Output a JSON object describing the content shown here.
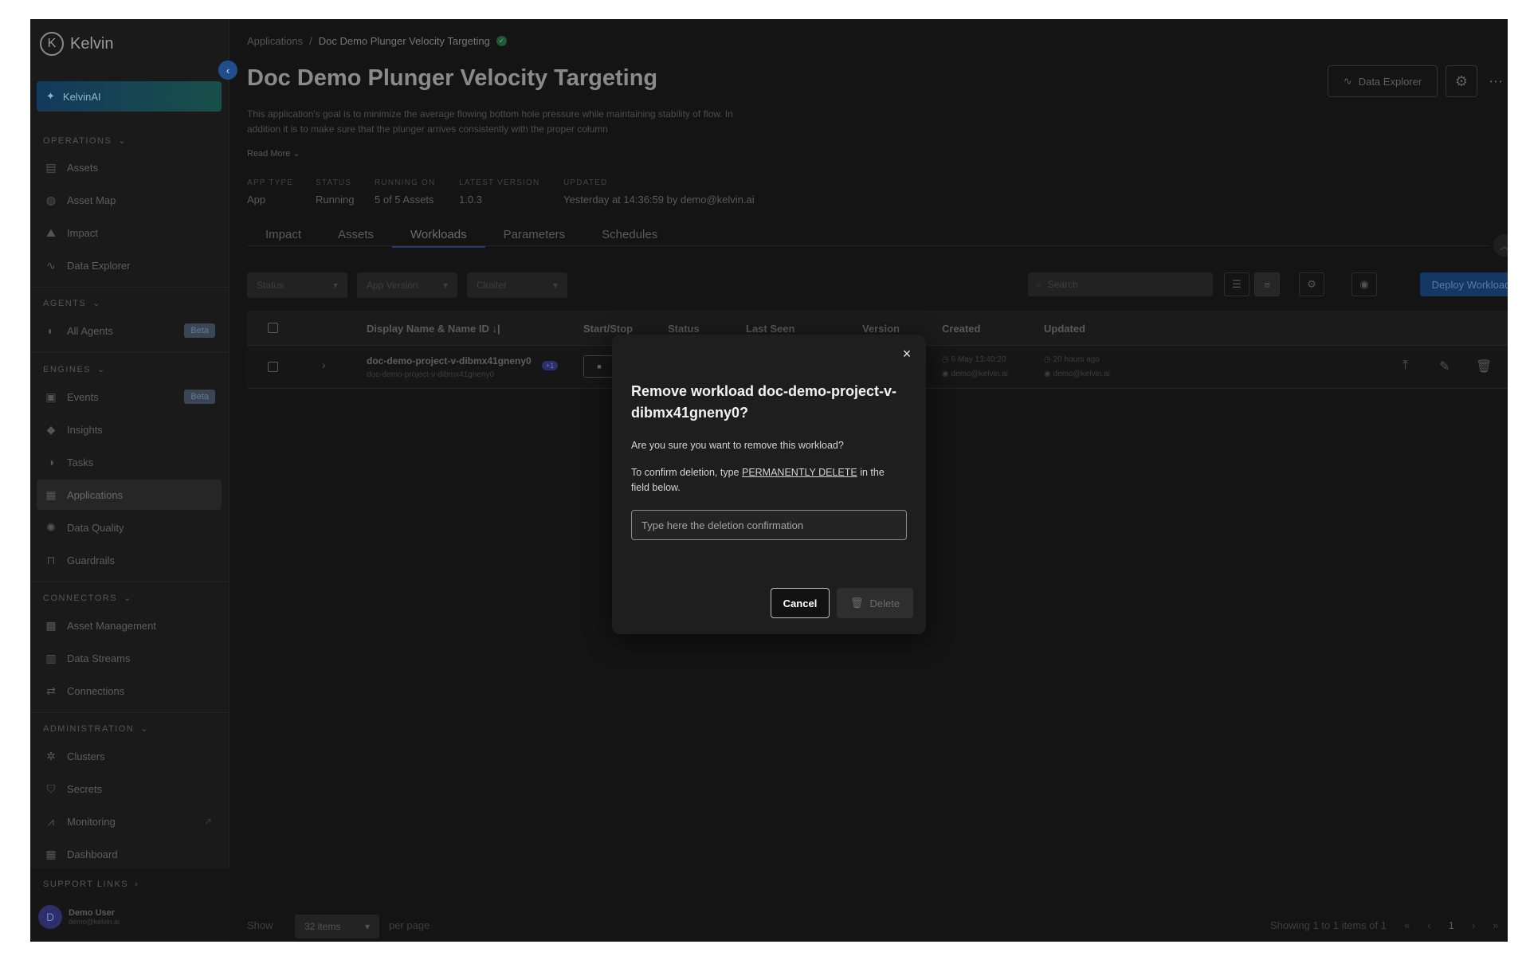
{
  "sidebar": {
    "logo_text": "Kelvin",
    "logo_mark": "K",
    "kelvinai_label": "KelvinAI",
    "sections": {
      "operations": "OPERATIONS",
      "agents": "AGENTS",
      "engines": "ENGINES",
      "connectors": "CONNECTORS",
      "administration": "ADMINISTRATION",
      "support": "SUPPORT LINKS"
    },
    "items": {
      "assets": "Assets",
      "asset_map": "Asset Map",
      "impact": "Impact",
      "data_explorer": "Data Explorer",
      "all_agents": "All Agents",
      "events": "Events",
      "insights": "Insights",
      "tasks": "Tasks",
      "applications": "Applications",
      "data_quality": "Data Quality",
      "guardrails": "Guardrails",
      "asset_management": "Asset Management",
      "data_streams": "Data Streams",
      "connections": "Connections",
      "clusters": "Clusters",
      "secrets": "Secrets",
      "monitoring": "Monitoring",
      "dashboard": "Dashboard"
    },
    "beta_label": "Beta",
    "user": {
      "initial": "D",
      "name": "Demo User",
      "email": "demo@kelvin.ai"
    }
  },
  "header": {
    "breadcrumb_root": "Applications",
    "breadcrumb_sep": "/",
    "breadcrumb_current": "Doc Demo Plunger Velocity Targeting",
    "title": "Doc Demo Plunger Velocity Targeting",
    "description": "This application's goal is to minimize the average flowing bottom hole pressure while maintaining stability of flow. In addition it is to make sure that the plunger arrives consistently with the proper column",
    "read_more": "Read More",
    "data_explorer_btn": "Data Explorer",
    "meta": {
      "app_type_label": "APP TYPE",
      "app_type": "App",
      "status_label": "STATUS",
      "status": "Running",
      "running_on_label": "RUNNING ON",
      "running_on": "5 of 5 Assets",
      "latest_version_label": "LATEST VERSION",
      "latest_version": "1.0.3",
      "updated_label": "UPDATED",
      "updated": "Yesterday at 14:36:59 by demo@kelvin.ai"
    }
  },
  "tabs": [
    "Impact",
    "Assets",
    "Workloads",
    "Parameters",
    "Schedules"
  ],
  "filters": {
    "status": "Status",
    "app_version": "App Version",
    "cluster": "Cluster",
    "search_placeholder": "Search",
    "deploy": "Deploy Workload"
  },
  "table": {
    "headers": {
      "name": "Display Name & Name ID",
      "start_stop": "Start/Stop",
      "status": "Status",
      "last_seen": "Last Seen",
      "version": "Version",
      "created": "Created",
      "updated": "Updated"
    },
    "row": {
      "display_name": "doc-demo-project-v-dibmx41gneny0",
      "name_id": "doc-demo-project-v-dibmx41gneny0",
      "badge": "+1",
      "created_time": "6 May 13:40:20",
      "created_by": "demo@kelvin.ai",
      "updated_time": "20 hours ago",
      "updated_by": "demo@kelvin.ai"
    }
  },
  "pagination": {
    "show": "Show",
    "per_page_value": "32 items",
    "per_page": "per page",
    "showing": "Showing 1 to 1 items of 1",
    "page": "1"
  },
  "modal": {
    "title": "Remove workload doc-demo-project-v-dibmx41gneny0?",
    "question": "Are you sure you want to remove this workload?",
    "confirm_prefix": "To confirm deletion, type",
    "confirm_keyword": "PERMANENTLY DELETE",
    "confirm_suffix": "in the field below.",
    "input_placeholder": "Type here the deletion confirmation",
    "input_value": "",
    "cancel": "Cancel",
    "delete": "Delete"
  }
}
